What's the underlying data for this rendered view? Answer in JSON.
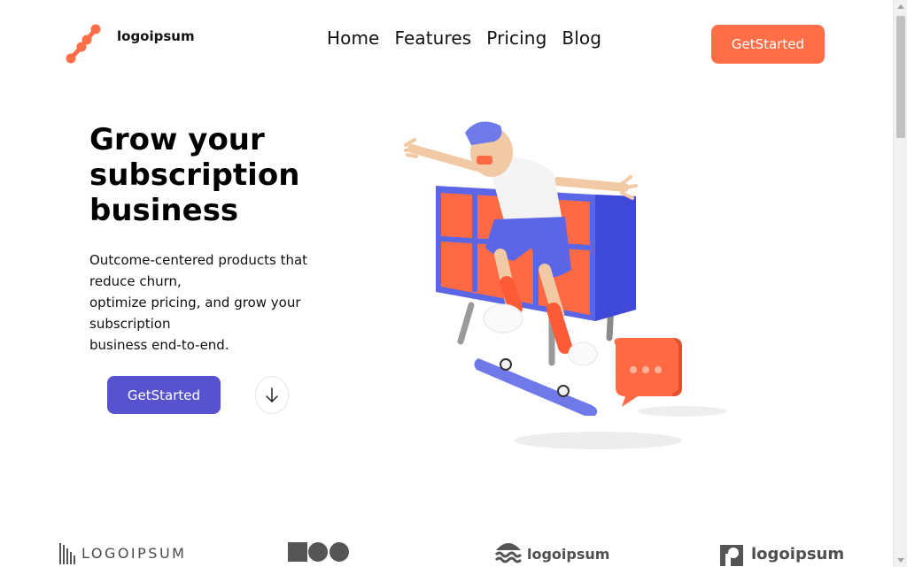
{
  "brand": {
    "name": "logoipsum",
    "accent": "#ff6e47"
  },
  "nav": {
    "items": [
      "Home",
      "Features",
      "Pricing",
      "Blog"
    ]
  },
  "header": {
    "cta_label": "GetStarted"
  },
  "hero": {
    "title": "Grow your subscription business",
    "description_lines": [
      "Outcome-centered products that reduce churn,",
      "optimize pricing, and grow your subscription",
      "business end-to-end."
    ],
    "cta_label": "GetStarted",
    "scroll_icon": "arrow-down-icon",
    "illustration": "skateboarder-illustration"
  },
  "partners": {
    "logos": [
      "LOGOIPSUM",
      "logoipsum",
      "logoipsum"
    ]
  },
  "colors": {
    "primary": "#5753cf",
    "accent": "#ff6e47"
  }
}
